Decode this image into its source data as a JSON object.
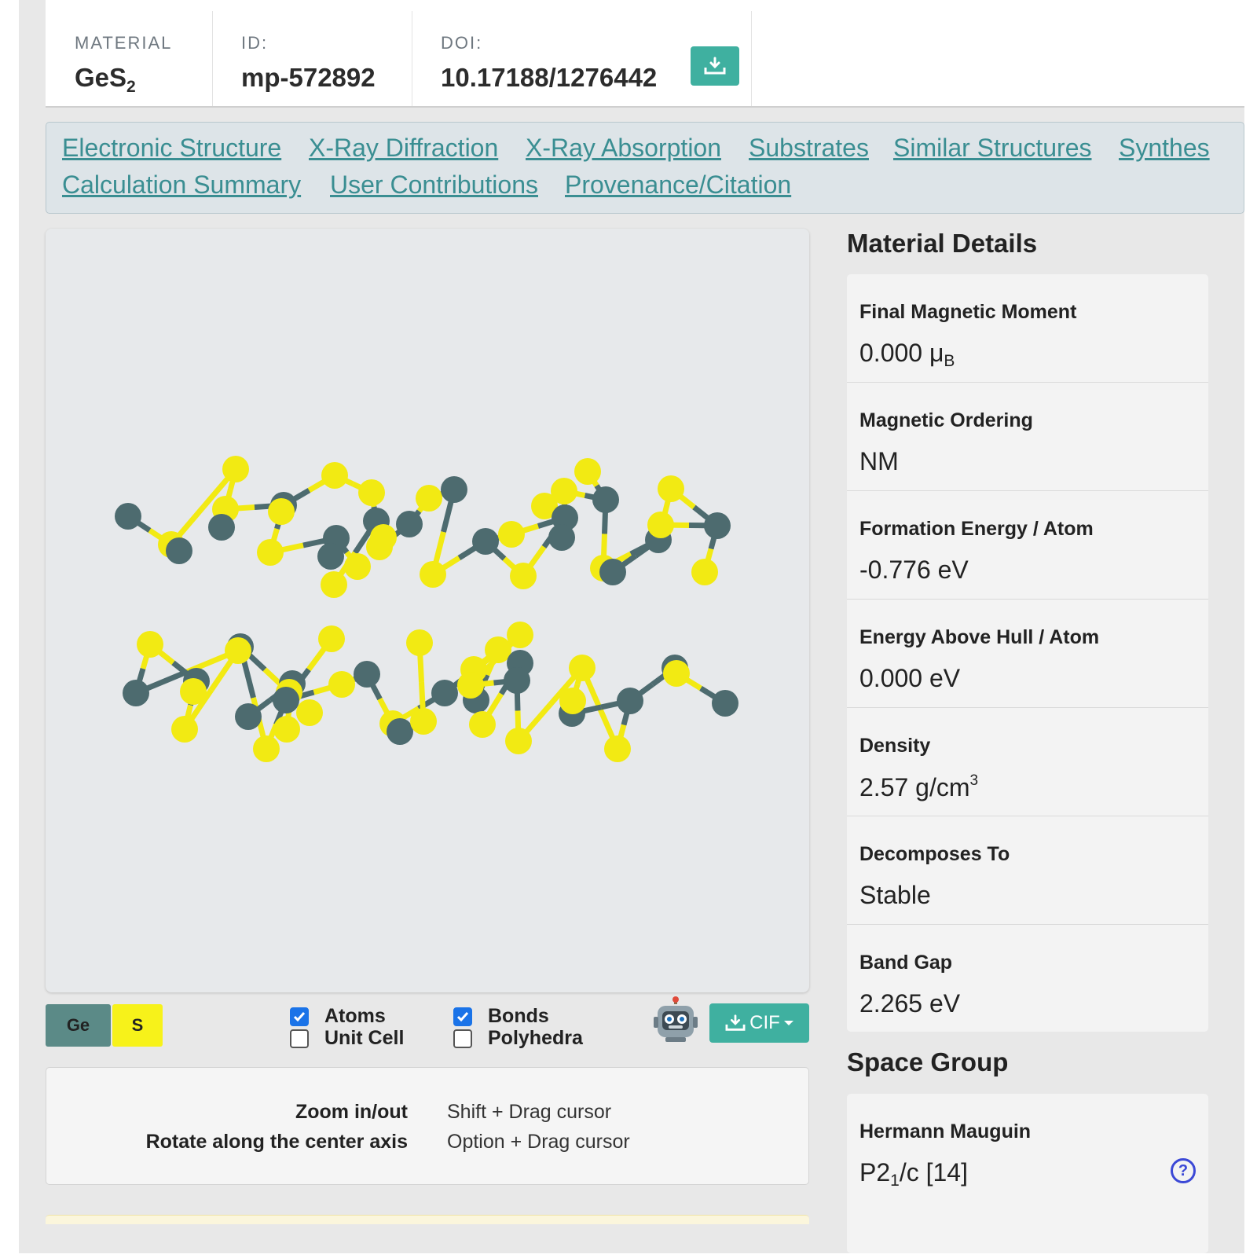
{
  "header": {
    "material_label": "MATERIAL",
    "material_formula": "GeS",
    "material_subscript": "2",
    "id_label": "ID:",
    "id_value": "mp-572892",
    "doi_label": "DOI:",
    "doi_value": "10.17188/1276442",
    "download_icon": "download-tray-icon"
  },
  "tabs": [
    "Electronic Structure",
    "X-Ray Diffraction",
    "X-Ray Absorption",
    "Substrates",
    "Similar Structures",
    "Synthes",
    "Calculation Summary",
    "User Contributions",
    "Provenance/Citation"
  ],
  "viewer": {
    "colors": {
      "Ge": "#4d6b6f",
      "S": "#f2ea13",
      "background": "#e7e9eb"
    }
  },
  "controls": {
    "elements": [
      {
        "label": "Ge",
        "color": "#5b8a87"
      },
      {
        "label": "S",
        "color": "#f7f21a"
      }
    ],
    "atoms_label": "Atoms",
    "atoms_checked": true,
    "unit_cell_label": "Unit Cell",
    "unit_cell_checked": false,
    "bonds_label": "Bonds",
    "bonds_checked": true,
    "polyhedra_label": "Polyhedra",
    "polyhedra_checked": false,
    "robot_icon": "robot-icon",
    "cif_label": "CIF"
  },
  "help": [
    {
      "key": "Zoom in/out",
      "value": "Shift + Drag cursor"
    },
    {
      "key": "Rotate along the center axis",
      "value": "Option + Drag cursor"
    }
  ],
  "material_details": {
    "title": "Material Details",
    "rows": [
      {
        "label": "Final Magnetic Moment",
        "value": "0.000 μ",
        "sub": "B"
      },
      {
        "label": "Magnetic Ordering",
        "value": "NM"
      },
      {
        "label": "Formation Energy / Atom",
        "value": "-0.776 eV"
      },
      {
        "label": "Energy Above Hull / Atom",
        "value": "0.000 eV"
      },
      {
        "label": "Density",
        "value": "2.57 g/cm",
        "sup": "3"
      },
      {
        "label": "Decomposes To",
        "value": "Stable"
      },
      {
        "label": "Band Gap",
        "value": "2.265 eV"
      }
    ]
  },
  "space_group": {
    "title": "Space Group",
    "hm_label": "Hermann Mauguin",
    "hm_value_a": "P2",
    "hm_value_sub": "1",
    "hm_value_b": "/c [14]",
    "help_icon": "question-circle-icon"
  }
}
